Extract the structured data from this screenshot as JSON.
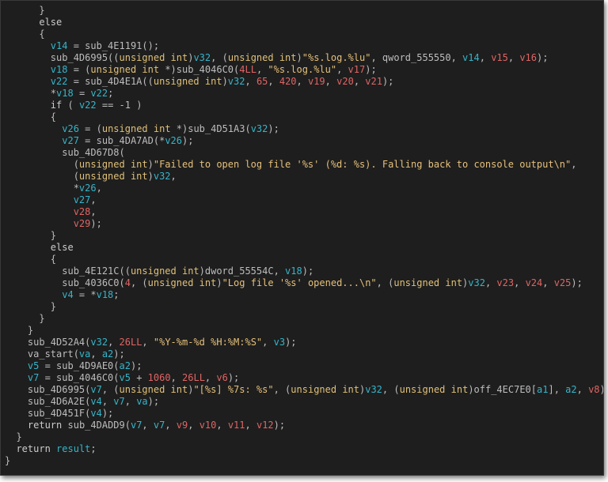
{
  "window": {
    "background": "#1e1e1e"
  },
  "colors": {
    "punctuation": "#bdbdbd",
    "identifier": "#bdbdbd",
    "local_variable": "#35b5ca",
    "keyword": "#e0c077",
    "string": "#e5c07b",
    "number": "#e06464"
  },
  "code_lines": [
    [
      {
        "t": "      }",
        "c": "p"
      }
    ],
    [
      {
        "t": "      else",
        "c": "kw"
      }
    ],
    [
      {
        "t": "      {",
        "c": "p"
      }
    ],
    [
      {
        "t": "        ",
        "c": "p"
      },
      {
        "t": "v14",
        "c": "v"
      },
      {
        "t": " = sub_4E1191();",
        "c": "id"
      }
    ],
    [
      {
        "t": "        sub_4D6995((",
        "c": "id"
      },
      {
        "t": "unsigned int",
        "c": "k"
      },
      {
        "t": ")",
        "c": "p"
      },
      {
        "t": "v32",
        "c": "v"
      },
      {
        "t": ", (",
        "c": "p"
      },
      {
        "t": "unsigned int",
        "c": "k"
      },
      {
        "t": ")",
        "c": "p"
      },
      {
        "t": "\"%s.log.%lu\"",
        "c": "s"
      },
      {
        "t": ", qword_555550, ",
        "c": "id"
      },
      {
        "t": "v14",
        "c": "v"
      },
      {
        "t": ", ",
        "c": "p"
      },
      {
        "t": "v15",
        "c": "n"
      },
      {
        "t": ", ",
        "c": "p"
      },
      {
        "t": "v16",
        "c": "n"
      },
      {
        "t": ");",
        "c": "p"
      }
    ],
    [
      {
        "t": "        ",
        "c": "p"
      },
      {
        "t": "v18",
        "c": "v"
      },
      {
        "t": " = (",
        "c": "p"
      },
      {
        "t": "unsigned int",
        "c": "k"
      },
      {
        "t": " *)sub_4046C0(",
        "c": "id"
      },
      {
        "t": "4LL",
        "c": "n"
      },
      {
        "t": ", ",
        "c": "p"
      },
      {
        "t": "\"%s.log.%lu\"",
        "c": "s"
      },
      {
        "t": ", ",
        "c": "p"
      },
      {
        "t": "v17",
        "c": "n"
      },
      {
        "t": ");",
        "c": "p"
      }
    ],
    [
      {
        "t": "        ",
        "c": "p"
      },
      {
        "t": "v22",
        "c": "v"
      },
      {
        "t": " = sub_4D4E1A((",
        "c": "id"
      },
      {
        "t": "unsigned int",
        "c": "k"
      },
      {
        "t": ")",
        "c": "p"
      },
      {
        "t": "v32",
        "c": "v"
      },
      {
        "t": ", ",
        "c": "p"
      },
      {
        "t": "65",
        "c": "n"
      },
      {
        "t": ", ",
        "c": "p"
      },
      {
        "t": "420",
        "c": "n"
      },
      {
        "t": ", ",
        "c": "p"
      },
      {
        "t": "v19",
        "c": "n"
      },
      {
        "t": ", ",
        "c": "p"
      },
      {
        "t": "v20",
        "c": "n"
      },
      {
        "t": ", ",
        "c": "p"
      },
      {
        "t": "v21",
        "c": "n"
      },
      {
        "t": ");",
        "c": "p"
      }
    ],
    [
      {
        "t": "        *",
        "c": "p"
      },
      {
        "t": "v18",
        "c": "v"
      },
      {
        "t": " = ",
        "c": "p"
      },
      {
        "t": "v22",
        "c": "v"
      },
      {
        "t": ";",
        "c": "p"
      }
    ],
    [
      {
        "t": "        ",
        "c": "p"
      },
      {
        "t": "if",
        "c": "kw"
      },
      {
        "t": " ( ",
        "c": "p"
      },
      {
        "t": "v22",
        "c": "v"
      },
      {
        "t": " == -1 )",
        "c": "p"
      }
    ],
    [
      {
        "t": "        {",
        "c": "p"
      }
    ],
    [
      {
        "t": "          ",
        "c": "p"
      },
      {
        "t": "v26",
        "c": "v"
      },
      {
        "t": " = (",
        "c": "p"
      },
      {
        "t": "unsigned int",
        "c": "k"
      },
      {
        "t": " *)sub_4D51A3(",
        "c": "id"
      },
      {
        "t": "v32",
        "c": "v"
      },
      {
        "t": ");",
        "c": "p"
      }
    ],
    [
      {
        "t": "          ",
        "c": "p"
      },
      {
        "t": "v27",
        "c": "v"
      },
      {
        "t": " = sub_4DA7AD(*",
        "c": "id"
      },
      {
        "t": "v26",
        "c": "v"
      },
      {
        "t": ");",
        "c": "p"
      }
    ],
    [
      {
        "t": "          sub_4D67D8(",
        "c": "id"
      }
    ],
    [
      {
        "t": "            (",
        "c": "p"
      },
      {
        "t": "unsigned int",
        "c": "k"
      },
      {
        "t": ")",
        "c": "p"
      },
      {
        "t": "\"Failed to open log file '%s' (%d: %s). Falling back to console output\\n\"",
        "c": "s"
      },
      {
        "t": ",",
        "c": "p"
      }
    ],
    [
      {
        "t": "            (",
        "c": "p"
      },
      {
        "t": "unsigned int",
        "c": "k"
      },
      {
        "t": ")",
        "c": "p"
      },
      {
        "t": "v32",
        "c": "v"
      },
      {
        "t": ",",
        "c": "p"
      }
    ],
    [
      {
        "t": "            *",
        "c": "p"
      },
      {
        "t": "v26",
        "c": "v"
      },
      {
        "t": ",",
        "c": "p"
      }
    ],
    [
      {
        "t": "            ",
        "c": "p"
      },
      {
        "t": "v27",
        "c": "v"
      },
      {
        "t": ",",
        "c": "p"
      }
    ],
    [
      {
        "t": "            ",
        "c": "p"
      },
      {
        "t": "v28",
        "c": "n"
      },
      {
        "t": ",",
        "c": "p"
      }
    ],
    [
      {
        "t": "            ",
        "c": "p"
      },
      {
        "t": "v29",
        "c": "n"
      },
      {
        "t": ");",
        "c": "p"
      }
    ],
    [
      {
        "t": "        }",
        "c": "p"
      }
    ],
    [
      {
        "t": "        else",
        "c": "kw"
      }
    ],
    [
      {
        "t": "        {",
        "c": "p"
      }
    ],
    [
      {
        "t": "          sub_4E121C((",
        "c": "id"
      },
      {
        "t": "unsigned int",
        "c": "k"
      },
      {
        "t": ")dword_55554C, ",
        "c": "id"
      },
      {
        "t": "v18",
        "c": "v"
      },
      {
        "t": ");",
        "c": "p"
      }
    ],
    [
      {
        "t": "          sub_4036C0(",
        "c": "id"
      },
      {
        "t": "4",
        "c": "n"
      },
      {
        "t": ", (",
        "c": "p"
      },
      {
        "t": "unsigned int",
        "c": "k"
      },
      {
        "t": ")",
        "c": "p"
      },
      {
        "t": "\"Log file '%s' opened...\\n\"",
        "c": "s"
      },
      {
        "t": ", (",
        "c": "p"
      },
      {
        "t": "unsigned int",
        "c": "k"
      },
      {
        "t": ")",
        "c": "p"
      },
      {
        "t": "v32",
        "c": "v"
      },
      {
        "t": ", ",
        "c": "p"
      },
      {
        "t": "v23",
        "c": "n"
      },
      {
        "t": ", ",
        "c": "p"
      },
      {
        "t": "v24",
        "c": "n"
      },
      {
        "t": ", ",
        "c": "p"
      },
      {
        "t": "v25",
        "c": "n"
      },
      {
        "t": ");",
        "c": "p"
      }
    ],
    [
      {
        "t": "          ",
        "c": "p"
      },
      {
        "t": "v4",
        "c": "v"
      },
      {
        "t": " = *",
        "c": "p"
      },
      {
        "t": "v18",
        "c": "v"
      },
      {
        "t": ";",
        "c": "p"
      }
    ],
    [
      {
        "t": "        }",
        "c": "p"
      }
    ],
    [
      {
        "t": "      }",
        "c": "p"
      }
    ],
    [
      {
        "t": "    }",
        "c": "p"
      }
    ],
    [
      {
        "t": "    sub_4D52A4(",
        "c": "id"
      },
      {
        "t": "v32",
        "c": "v"
      },
      {
        "t": ", ",
        "c": "p"
      },
      {
        "t": "26LL",
        "c": "n"
      },
      {
        "t": ", ",
        "c": "p"
      },
      {
        "t": "\"%Y-%m-%d %H:%M:%S\"",
        "c": "s"
      },
      {
        "t": ", ",
        "c": "p"
      },
      {
        "t": "v3",
        "c": "v"
      },
      {
        "t": ");",
        "c": "p"
      }
    ],
    [
      {
        "t": "    va_start(",
        "c": "id"
      },
      {
        "t": "va",
        "c": "v"
      },
      {
        "t": ", ",
        "c": "p"
      },
      {
        "t": "a2",
        "c": "v"
      },
      {
        "t": ");",
        "c": "p"
      }
    ],
    [
      {
        "t": "    ",
        "c": "p"
      },
      {
        "t": "v5",
        "c": "v"
      },
      {
        "t": " = sub_4D9AE0(",
        "c": "id"
      },
      {
        "t": "a2",
        "c": "v"
      },
      {
        "t": ");",
        "c": "p"
      }
    ],
    [
      {
        "t": "    ",
        "c": "p"
      },
      {
        "t": "v7",
        "c": "v"
      },
      {
        "t": " = sub_4046C0(",
        "c": "id"
      },
      {
        "t": "v5",
        "c": "v"
      },
      {
        "t": " + ",
        "c": "p"
      },
      {
        "t": "1060",
        "c": "n"
      },
      {
        "t": ", ",
        "c": "p"
      },
      {
        "t": "26LL",
        "c": "n"
      },
      {
        "t": ", ",
        "c": "p"
      },
      {
        "t": "v6",
        "c": "n"
      },
      {
        "t": ");",
        "c": "p"
      }
    ],
    [
      {
        "t": "    sub_4D6995(",
        "c": "id"
      },
      {
        "t": "v7",
        "c": "v"
      },
      {
        "t": ", (",
        "c": "p"
      },
      {
        "t": "unsigned int",
        "c": "k"
      },
      {
        "t": ")",
        "c": "p"
      },
      {
        "t": "\"[%s] %7s: %s\"",
        "c": "s"
      },
      {
        "t": ", (",
        "c": "p"
      },
      {
        "t": "unsigned int",
        "c": "k"
      },
      {
        "t": ")",
        "c": "p"
      },
      {
        "t": "v32",
        "c": "v"
      },
      {
        "t": ", (",
        "c": "p"
      },
      {
        "t": "unsigned int",
        "c": "k"
      },
      {
        "t": ")off_4EC7E0[",
        "c": "id"
      },
      {
        "t": "a1",
        "c": "v"
      },
      {
        "t": "], ",
        "c": "p"
      },
      {
        "t": "a2",
        "c": "v"
      },
      {
        "t": ", ",
        "c": "p"
      },
      {
        "t": "v8",
        "c": "n"
      },
      {
        "t": ");",
        "c": "p"
      }
    ],
    [
      {
        "t": "    sub_4D6A2E(",
        "c": "id"
      },
      {
        "t": "v4",
        "c": "v"
      },
      {
        "t": ", ",
        "c": "p"
      },
      {
        "t": "v7",
        "c": "v"
      },
      {
        "t": ", ",
        "c": "p"
      },
      {
        "t": "va",
        "c": "v"
      },
      {
        "t": ");",
        "c": "p"
      }
    ],
    [
      {
        "t": "    sub_4D451F(",
        "c": "id"
      },
      {
        "t": "v4",
        "c": "v"
      },
      {
        "t": ");",
        "c": "p"
      }
    ],
    [
      {
        "t": "    ",
        "c": "p"
      },
      {
        "t": "return",
        "c": "kw"
      },
      {
        "t": " sub_4DADD9(",
        "c": "id"
      },
      {
        "t": "v7",
        "c": "v"
      },
      {
        "t": ", ",
        "c": "p"
      },
      {
        "t": "v7",
        "c": "v"
      },
      {
        "t": ", ",
        "c": "p"
      },
      {
        "t": "v9",
        "c": "n"
      },
      {
        "t": ", ",
        "c": "p"
      },
      {
        "t": "v10",
        "c": "n"
      },
      {
        "t": ", ",
        "c": "p"
      },
      {
        "t": "v11",
        "c": "n"
      },
      {
        "t": ", ",
        "c": "p"
      },
      {
        "t": "v12",
        "c": "n"
      },
      {
        "t": ");",
        "c": "p"
      }
    ],
    [
      {
        "t": "  }",
        "c": "p"
      }
    ],
    [
      {
        "t": "  ",
        "c": "p"
      },
      {
        "t": "return",
        "c": "kw"
      },
      {
        "t": " ",
        "c": "p"
      },
      {
        "t": "result",
        "c": "v"
      },
      {
        "t": ";",
        "c": "p"
      }
    ],
    [
      {
        "t": "}",
        "c": "p"
      }
    ]
  ]
}
